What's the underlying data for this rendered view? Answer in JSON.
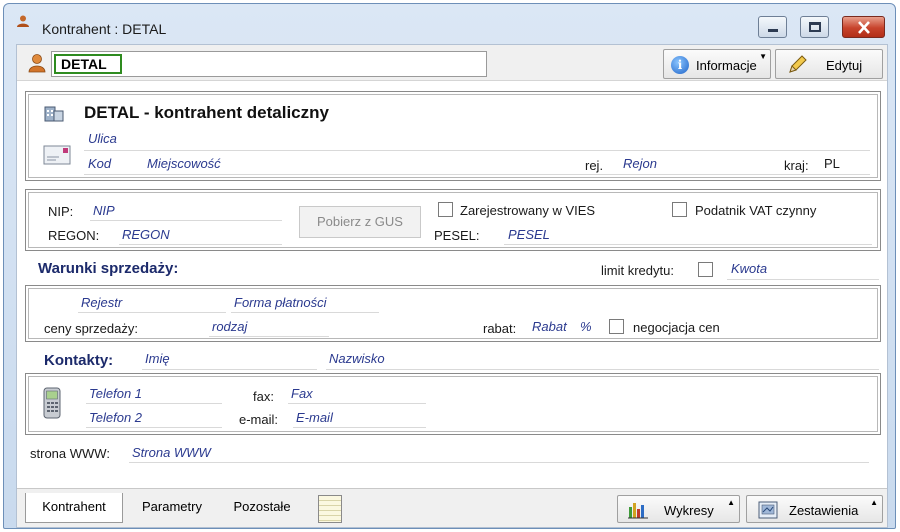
{
  "window": {
    "title": "Kontrahent : DETAL",
    "controls": {
      "minimize_icon": "minimize-icon",
      "maximize_icon": "maximize-icon",
      "close_icon": "close-icon"
    }
  },
  "toolbar": {
    "code": "DETAL",
    "info_label": "Informacje",
    "edit_label": "Edytuj"
  },
  "address": {
    "name": "DETAL - kontrahent detaliczny",
    "street": "Ulica",
    "postal_code": "Kod",
    "city": "Miejscowość",
    "region_label": "rej.",
    "region": "Rejon",
    "country_label": "kraj:",
    "country": "PL"
  },
  "ids": {
    "nip_label": "NIP:",
    "nip": "NIP",
    "regon_label": "REGON:",
    "regon": "REGON",
    "gus_button": "Pobierz z GUS",
    "vies_label": "Zarejestrowany w VIES",
    "vat_label": "Podatnik VAT czynny",
    "pesel_label": "PESEL:",
    "pesel": "PESEL"
  },
  "sales": {
    "title": "Warunki sprzedaży:",
    "credit_limit_label": "limit kredytu:",
    "amount": "Kwota",
    "register": "Rejestr",
    "payment_form": "Forma płatności",
    "prices_label": "ceny sprzedaży:",
    "kind": "rodzaj",
    "discount_label": "rabat:",
    "discount": "Rabat",
    "percent": "%",
    "negotiation_label": "negocjacja cen"
  },
  "contacts": {
    "title": "Kontakty:",
    "first_name": "Imię",
    "last_name": "Nazwisko",
    "phone1": "Telefon 1",
    "phone2": "Telefon 2",
    "fax_label": "fax:",
    "fax": "Fax",
    "email_label": "e-mail:",
    "email": "E-mail",
    "www_label": "strona WWW:",
    "www": "Strona WWW"
  },
  "tabs": [
    "Kontrahent",
    "Parametry",
    "Pozostałe"
  ],
  "bottom_buttons": {
    "charts": "Wykresy",
    "reports": "Zestawienia"
  },
  "colors": {
    "accent_green": "#2e8b1f",
    "placeholder_blue": "#2b3a8f",
    "close_red": "#c7432c"
  }
}
